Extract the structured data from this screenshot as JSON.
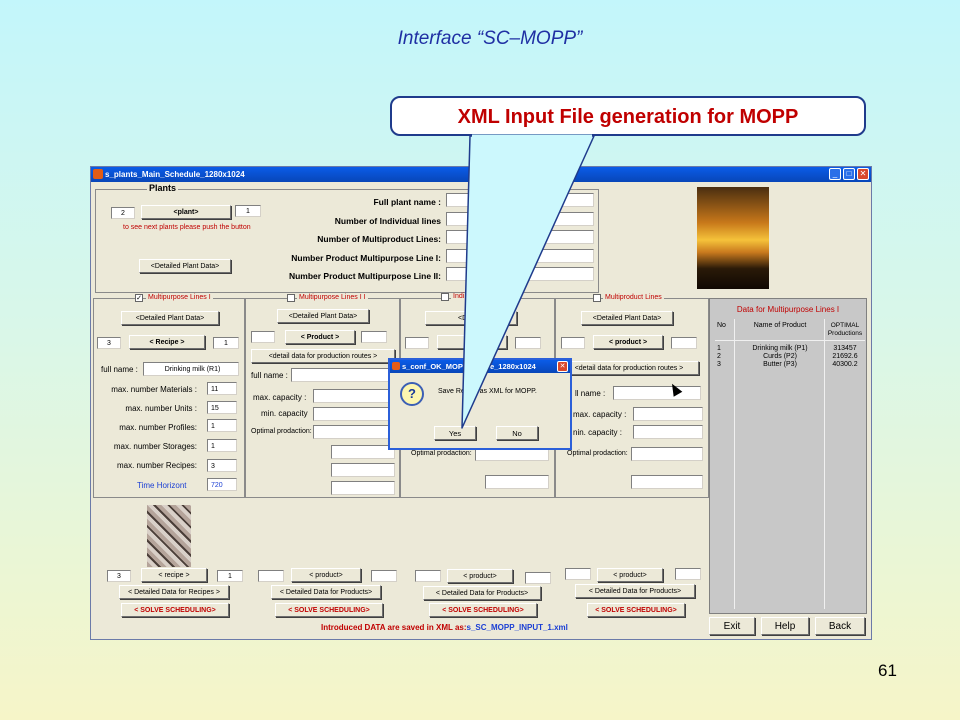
{
  "slide": {
    "title": "Interface “SC–MOPP”",
    "callout": "XML Input File generation for MOPP",
    "page_number": "61"
  },
  "window": {
    "title": "s_plants_Main_Schedule_1280x1024",
    "minimize": "_",
    "maximize": "□",
    "close": "✕",
    "plants": {
      "legend": "Plants",
      "count_value": "2",
      "nav_button": "<plant>",
      "index_value": "1",
      "hint": "to see next plants please push the button",
      "detail_button": "<Detailed Plant Data>",
      "labels": {
        "full_name": "Full plant name :",
        "individual_lines": "Number of Individual lines",
        "multiproduct_lines": "Number  of Multiproduct Lines:",
        "multipurpose_1": "Number Product Multipurpose Line  I:",
        "multipurpose_2": "Number Product Multipurpose Line II:"
      }
    },
    "col1": {
      "checkbox": "✓",
      "title": "Multipurpose Lines I",
      "detail_button": "<Detailed Plant Data>",
      "count_value": "3",
      "recipe_button": "< Recipe >",
      "index_value": "1",
      "full_name_label": "full name :",
      "full_name_value": "Drinking milk (R1)",
      "rows": [
        {
          "label": "max. number Materials :",
          "value": "11"
        },
        {
          "label": "max. number Units :",
          "value": "15"
        },
        {
          "label": "max. number Profiles:",
          "value": "1"
        },
        {
          "label": "max. number Storages:",
          "value": "1"
        },
        {
          "label": "max. number Recipes:",
          "value": "3"
        }
      ],
      "horizon_label": "Time Horizont",
      "horizon_value": "720"
    },
    "col2": {
      "title": "Multipurpose Lines I I",
      "detail_button": "<Detailed Plant Data>",
      "product_button": "< Product >",
      "routes_button": "<detail data for production routes >",
      "full_name_label": "full name :",
      "max_capacity_label": "max. capacity :",
      "min_capacity_label": "min. capacity",
      "optimal_label": "Optimal prodaction:"
    },
    "col3": {
      "title": "Indi",
      "detail_button": "<Detaile",
      "product_button": "< p",
      "optimal_label": "Optimal prodaction:"
    },
    "col4": {
      "title": "Multiproduct Lines",
      "detail_button": "<Detailed Plant Data>",
      "product_button": "< product >",
      "routes_button": "<detail data for production routes >",
      "full_name_label": "ll name :",
      "max_capacity_label": "max. capacity :",
      "min_capacity_label": "nin. capacity :",
      "optimal_label": "Optimal prodaction:"
    },
    "table": {
      "title": "Data for Multipurpose Lines I",
      "headers": [
        "No",
        "Name of Product",
        "OPTIMAL Productions"
      ],
      "rows": [
        [
          "1",
          "Drinking milk (P1)",
          "313457"
        ],
        [
          "2",
          "Curds (P2)",
          "21692.6"
        ],
        [
          "3",
          "Butter (P3)",
          "40300.2"
        ]
      ]
    },
    "bottom": {
      "col1": {
        "count_value": "3",
        "nav_button": "< recipe >",
        "index_value": "1",
        "detail_button": "< Detailed Data for Recipes >",
        "solve_button": "< SOLVE SCHEDULING>"
      },
      "col2": {
        "nav_button": "< product>",
        "detail_button": "< Detailed Data for Products>",
        "solve_button": "< SOLVE SCHEDULING>"
      },
      "col3": {
        "nav_button": "< product>",
        "detail_button": "< Detailed Data for Products>",
        "solve_button": "< SOLVE SCHEDULING>"
      },
      "col4": {
        "nav_button": "< product>",
        "detail_button": "< Detailed Data for Products>",
        "solve_button": "< SOLVE SCHEDULING>"
      },
      "status_label": "Introduced DATA are saved in XML as:",
      "status_file": "s_SC_MOPP_INPUT_1.xml"
    },
    "actions": {
      "exit": "Exit",
      "help": "Help",
      "back": "Back"
    }
  },
  "dialog": {
    "title": "s_conf_OK_MOPP_recipe_1280x1024",
    "close": "✕",
    "icon": "?",
    "message": "Save Recipe as XML for MOPP.",
    "yes": "Yes",
    "no": "No"
  }
}
